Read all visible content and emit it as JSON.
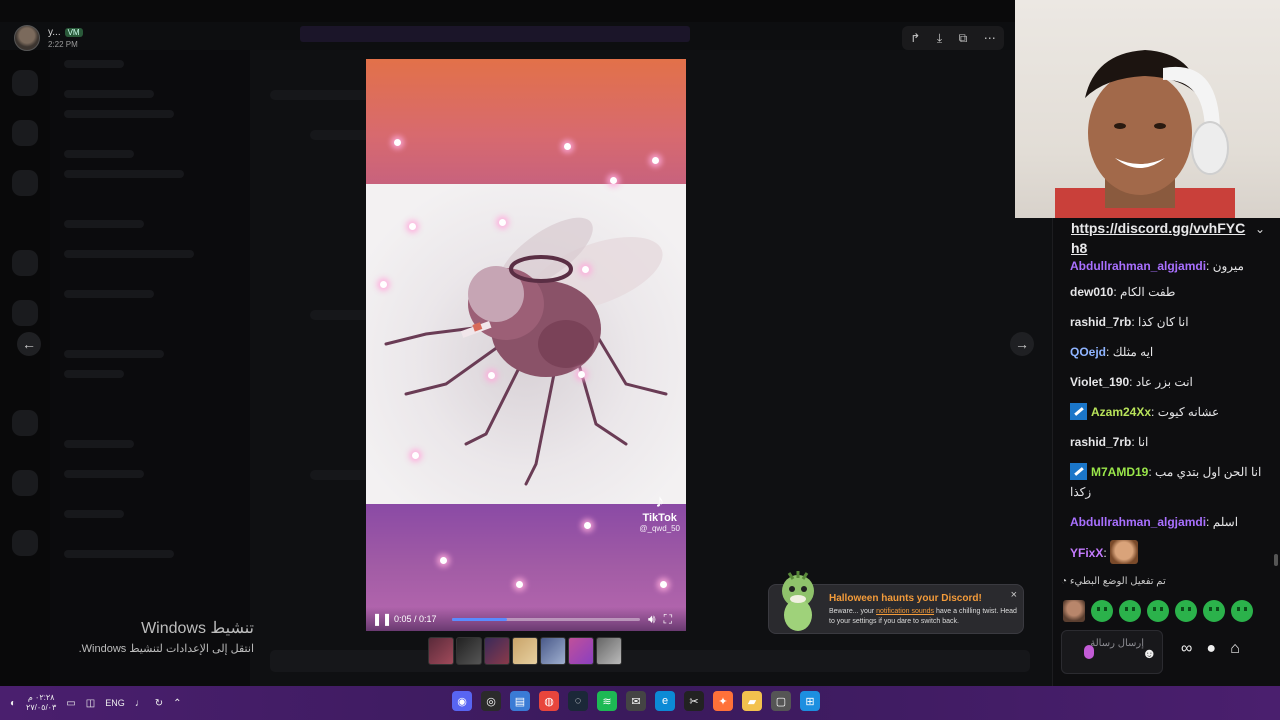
{
  "user": {
    "name": "y...",
    "badge": "VM",
    "time": "2:22 PM"
  },
  "viewer": {
    "toolbar_icons": [
      "forward-icon",
      "download-icon",
      "open-external-icon",
      "more-icon"
    ],
    "prev_arrow": "←",
    "next_arrow": "→"
  },
  "video": {
    "tiktok_label": "TikTok",
    "tiktok_user": "@_qwd_50",
    "time_display": "0:05 / 0:17",
    "progress": 0.294
  },
  "activation": {
    "title": "تنشيط Windows",
    "subtitle": "انتقل إلى الإعدادات لتنشيط Windows."
  },
  "toast": {
    "title": "Halloween haunts your Discord!",
    "body_prefix": "Beware... your ",
    "body_link": "notification sounds",
    "body_suffix": " have a chilling twist. Head to your settings if you dare to switch back.",
    "close": "×"
  },
  "chat": {
    "pinned_link": "https://discord.gg/vvhFYCh8",
    "messages": [
      {
        "user": "Abdullrahman_algjamdi",
        "text": "ميرون",
        "color": "#a970ff",
        "mod": false
      },
      {
        "user": "dew010",
        "text": "طفت الكام",
        "color": "#e6e6e8",
        "mod": false
      },
      {
        "user": "rashid_7rb",
        "text": "انا كان كذا",
        "color": "#e6e6e8",
        "mod": false
      },
      {
        "user": "QOejd",
        "text": "ايه مثلك",
        "color": "#8fb4ff",
        "mod": false
      },
      {
        "user": "Violet_190",
        "text": "انت بزر عاد",
        "color": "#e6e6e8",
        "mod": false
      },
      {
        "user": "Azam24Xx",
        "text": "عشانه كيوت",
        "color": "#b8e35a",
        "mod": true
      },
      {
        "user": "rashid_7rb",
        "text": "انا",
        "color": "#e6e6e8",
        "mod": false
      },
      {
        "user": "M7AMD19",
        "text": "انا الحن اول بتدي مب",
        "text2": "زكذا",
        "color": "#9ae64a",
        "mod": true
      },
      {
        "user": "Abdullrahman_algjamdi",
        "text": "اسلم",
        "color": "#a970ff",
        "mod": false
      },
      {
        "user": "YFixX",
        "text": "",
        "color": "#c47bff",
        "mod": false,
        "emote": true
      }
    ],
    "slow_mode": "تم تفعيل الوضع البطيء",
    "input_placeholder": "إرسال رسالة",
    "colors": {
      "background": "#0e0e10"
    }
  },
  "taskbar": {
    "clock_time": "٠٢:٢٨ م",
    "clock_date": "٢٧/٠٥/٠٣",
    "lang": "ENG",
    "apps": [
      "discord-icon",
      "obs-icon",
      "notepad-icon",
      "chrome-icon",
      "steam-icon",
      "spotify-icon",
      "mail-icon",
      "edge-icon",
      "capcut-icon",
      "firefox-icon",
      "explorer-icon",
      "window-icon",
      "windows-start-icon"
    ]
  }
}
